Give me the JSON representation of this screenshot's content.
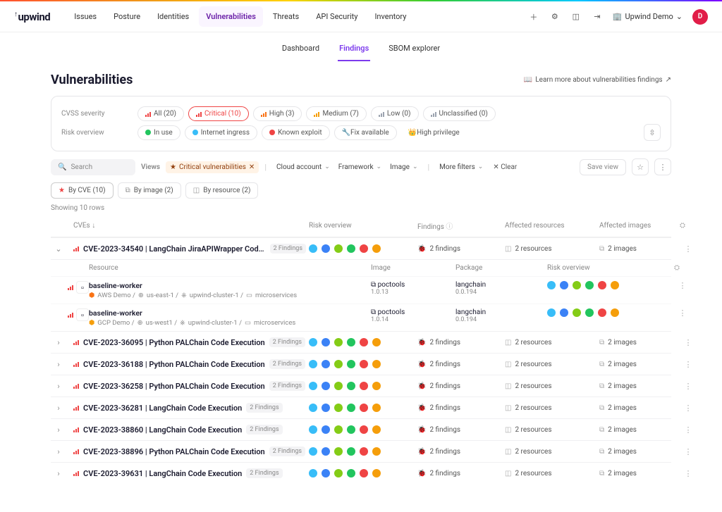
{
  "brand": "upwind",
  "nav": {
    "items": [
      "Issues",
      "Posture",
      "Identities",
      "Vulnerabilities",
      "Threats",
      "API Security",
      "Inventory"
    ],
    "active": 3
  },
  "org": {
    "name": "Upwind Demo",
    "avatar": "D"
  },
  "subnav": {
    "items": [
      "Dashboard",
      "Findings",
      "SBOM explorer"
    ],
    "active": 1
  },
  "page_title": "Vulnerabilities",
  "learn_more": "Learn more about vulnerabilities findings",
  "filters": {
    "severity_label": "CVSS severity",
    "severity": [
      {
        "label": "All (20)",
        "color": "#ef4444"
      },
      {
        "label": "Critical (10)",
        "color": "#ef4444",
        "selected": true
      },
      {
        "label": "High (3)",
        "color": "#f97316"
      },
      {
        "label": "Medium (7)",
        "color": "#f59e0b"
      },
      {
        "label": "Low (0)",
        "color": "#9ca3af"
      },
      {
        "label": "Unclassified (0)",
        "color": "#9ca3af"
      }
    ],
    "risk_label": "Risk overview",
    "risk": [
      {
        "label": "In use",
        "dot": "#22c55e"
      },
      {
        "label": "Internet ingress",
        "dot": "#38bdf8"
      },
      {
        "label": "Known exploit",
        "dot": "#ef4444"
      },
      {
        "label": "Fix available",
        "dot": "#f59e0b",
        "icon": "wrench"
      },
      {
        "label": "High privilege",
        "dot": "#f59e0b",
        "icon": "crown",
        "border": false
      }
    ]
  },
  "toolbar": {
    "search": "Search",
    "views_label": "Views",
    "view_chip": "Critical vulnerabilities",
    "dropdowns": [
      "Cloud account",
      "Framework",
      "Image"
    ],
    "more": "More filters",
    "clear": "Clear",
    "save": "Save view"
  },
  "groupers": [
    {
      "label": "By CVE (10)",
      "icon": "★",
      "active": true
    },
    {
      "label": "By image (2)",
      "icon": "⧉"
    },
    {
      "label": "By resource (2)",
      "icon": "◫"
    }
  ],
  "rows_info": "Showing 10 rows",
  "columns": {
    "c1": "CVEs",
    "c2": "Risk overview",
    "c3": "Findings",
    "c4": "Affected resources",
    "c5": "Affected images"
  },
  "risk_palette": [
    "#38bdf8",
    "#3b82f6",
    "#84cc16",
    "#22c55e",
    "#ef4444",
    "#f59e0b"
  ],
  "expanded": {
    "columns": {
      "c1": "Resource",
      "c2": "Image",
      "c3": "Package",
      "c4": "Risk overview"
    },
    "rows": [
      {
        "name": "baseline-worker",
        "provider": "AWS Demo",
        "provider_color": "#f97316",
        "region": "us-east-1",
        "cluster": "upwind-cluster-1",
        "ns": "microservices",
        "image": "poctools",
        "image_ver": "1.0.13",
        "pkg": "langchain",
        "pkg_ver": "0.0.194"
      },
      {
        "name": "baseline-worker",
        "provider": "GCP Demo",
        "provider_color": "#f59e0b",
        "region": "us-west1",
        "cluster": "upwind-cluster-1",
        "ns": "microservices",
        "image": "poctools",
        "image_ver": "1.0.14",
        "pkg": "langchain",
        "pkg_ver": "0.0.194"
      }
    ]
  },
  "cves": [
    {
      "id": "CVE-2023-34540",
      "title": "LangChain JiraAPIWrapper Code Executi…",
      "findings": "2 findings",
      "resources": "2 resources",
      "images": "2 images",
      "badge": "2 Findings",
      "expanded": true
    },
    {
      "id": "CVE-2023-36095",
      "title": "Python PALChain Code Execution",
      "findings": "2 findings",
      "resources": "2 resources",
      "images": "2 images",
      "badge": "2 Findings"
    },
    {
      "id": "CVE-2023-36188",
      "title": "Python PALChain Code Execution",
      "findings": "2 findings",
      "resources": "2 resources",
      "images": "2 images",
      "badge": "2 Findings"
    },
    {
      "id": "CVE-2023-36258",
      "title": "Python PALChain Code Execution",
      "findings": "2 findings",
      "resources": "2 resources",
      "images": "2 images",
      "badge": "2 Findings"
    },
    {
      "id": "CVE-2023-36281",
      "title": "LangChain Code Execution",
      "findings": "2 findings",
      "resources": "2 resources",
      "images": "2 images",
      "badge": "2 Findings"
    },
    {
      "id": "CVE-2023-38860",
      "title": "LangChain Code Execution",
      "findings": "2 findings",
      "resources": "2 resources",
      "images": "2 images",
      "badge": "2 Findings"
    },
    {
      "id": "CVE-2023-38896",
      "title": "Python PALChain Code Execution",
      "findings": "2 findings",
      "resources": "2 resources",
      "images": "2 images",
      "badge": "2 Findings"
    },
    {
      "id": "CVE-2023-39631",
      "title": "LangChain Code Execution",
      "findings": "2 findings",
      "resources": "2 resources",
      "images": "2 images",
      "badge": "2 Findings"
    }
  ]
}
